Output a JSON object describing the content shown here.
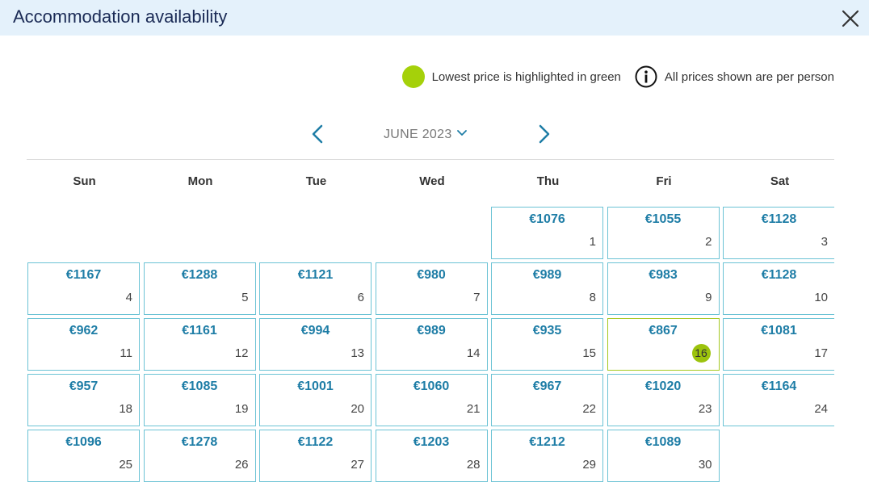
{
  "window": {
    "title": "Accommodation availability"
  },
  "legend": {
    "lowest_label": "Lowest price is highlighted in green",
    "per_person_label": "All prices shown are per person",
    "highlight_color": "#a5d10a"
  },
  "calendar": {
    "month_label": "JUNE 2023",
    "weekdays": [
      "Sun",
      "Mon",
      "Tue",
      "Wed",
      "Thu",
      "Fri",
      "Sat"
    ],
    "first_weekday_index": 4,
    "lowest_day": 16,
    "days": [
      {
        "day": "1",
        "price": "€1076"
      },
      {
        "day": "2",
        "price": "€1055"
      },
      {
        "day": "3",
        "price": "€1128"
      },
      {
        "day": "4",
        "price": "€1167"
      },
      {
        "day": "5",
        "price": "€1288"
      },
      {
        "day": "6",
        "price": "€1121"
      },
      {
        "day": "7",
        "price": "€980"
      },
      {
        "day": "8",
        "price": "€989"
      },
      {
        "day": "9",
        "price": "€983"
      },
      {
        "day": "10",
        "price": "€1128"
      },
      {
        "day": "11",
        "price": "€962"
      },
      {
        "day": "12",
        "price": "€1161"
      },
      {
        "day": "13",
        "price": "€994"
      },
      {
        "day": "14",
        "price": "€989"
      },
      {
        "day": "15",
        "price": "€935"
      },
      {
        "day": "16",
        "price": "€867"
      },
      {
        "day": "17",
        "price": "€1081"
      },
      {
        "day": "18",
        "price": "€957"
      },
      {
        "day": "19",
        "price": "€1085"
      },
      {
        "day": "20",
        "price": "€1001"
      },
      {
        "day": "21",
        "price": "€1060"
      },
      {
        "day": "22",
        "price": "€967"
      },
      {
        "day": "23",
        "price": "€1020"
      },
      {
        "day": "24",
        "price": "€1164"
      },
      {
        "day": "25",
        "price": "€1096"
      },
      {
        "day": "26",
        "price": "€1278"
      },
      {
        "day": "27",
        "price": "€1122"
      },
      {
        "day": "28",
        "price": "€1203"
      },
      {
        "day": "29",
        "price": "€1212"
      },
      {
        "day": "30",
        "price": "€1089"
      }
    ]
  }
}
